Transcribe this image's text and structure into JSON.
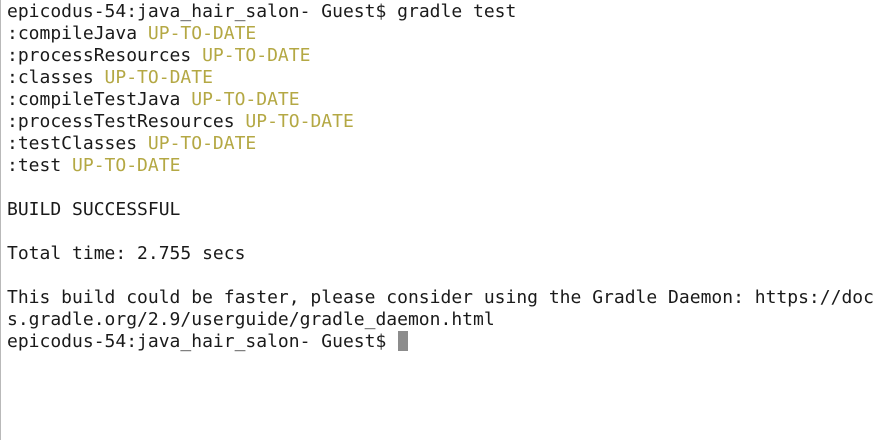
{
  "terminal": {
    "prompt": "epicodus-54:java_hair_salon- Guest$ ",
    "command": "gradle test",
    "tasks": [
      {
        "name": ":compileJava",
        "status": "UP-TO-DATE"
      },
      {
        "name": ":processResources",
        "status": "UP-TO-DATE"
      },
      {
        "name": ":classes",
        "status": "UP-TO-DATE"
      },
      {
        "name": ":compileTestJava",
        "status": "UP-TO-DATE"
      },
      {
        "name": ":processTestResources",
        "status": "UP-TO-DATE"
      },
      {
        "name": ":testClasses",
        "status": "UP-TO-DATE"
      },
      {
        "name": ":test",
        "status": "UP-TO-DATE"
      }
    ],
    "result": "BUILD SUCCESSFUL",
    "total_time": "Total time: 2.755 secs",
    "daemon_hint_line1": "This build could be faster, please consider using the Gradle Daemon: https://doc",
    "daemon_hint_line2": "s.gradle.org/2.9/userguide/gradle_daemon.html",
    "final_prompt": "epicodus-54:java_hair_salon- Guest$ ",
    "colors": {
      "status": "#b4a844",
      "text": "#1a1a1a",
      "cursor": "#8c8c8c",
      "background": "#ffffff"
    }
  }
}
